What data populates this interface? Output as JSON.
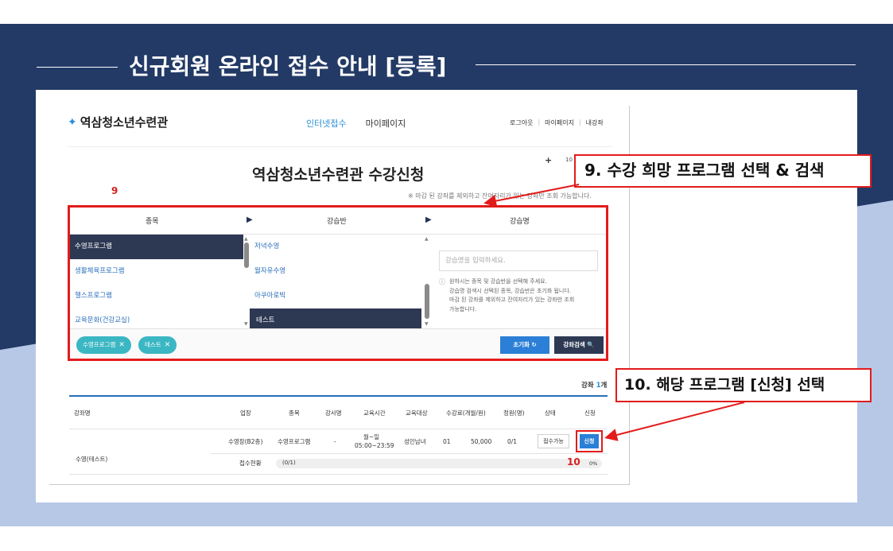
{
  "slide": {
    "title": "신규회원 온라인 접수 안내 [등록]",
    "colors": {
      "navy": "#233a66",
      "light_blue": "#b7c8e6",
      "callout_red": "#e31b1b"
    }
  },
  "site": {
    "logo_text": "역삼청소년수련관",
    "logo_icon": "sprout-icon",
    "nav": [
      "인터넷접수",
      "마이페이지"
    ],
    "util_nav": [
      "로그아웃",
      "마이페이지",
      "내강좌"
    ],
    "zoom_text": "10"
  },
  "page": {
    "heading": "역삼청소년수련관 수강신청",
    "marker_9": "9",
    "notice": "※ 마감 된 강좌를 제외하고 잔여자리가 있는 강좌만 조회 가능합니다."
  },
  "selector": {
    "headers": [
      "종목",
      "강습반",
      "강습명"
    ],
    "categories": [
      "수영프로그램",
      "생활체육프로그램",
      "헬스프로그램",
      "교육문화(건강교실)"
    ],
    "selected_category": 0,
    "classes": [
      "저녁수영",
      "월자유수영",
      "아쿠아로빅",
      "테스트"
    ],
    "selected_class": 3,
    "search_placeholder": "강습명을 입력하세요.",
    "help": [
      "원하시는 종목 및 강습반을 선택해 주세요.",
      "강습명 검색시 선택된 종목, 강습반은 초기화 됩니다.",
      "마감 된 강좌를 제외하고 잔여자리가 있는 강좌만 조회",
      "가능합니다."
    ],
    "chips": [
      "수영프로그램",
      "테스트"
    ],
    "reset_label": "초기화 ↻",
    "search_label": "강좌검색 🔍"
  },
  "results": {
    "count_label": "강좌",
    "count_value": "1",
    "count_unit": "개",
    "columns": [
      "강좌명",
      "업장",
      "종목",
      "강사명",
      "교육시간",
      "교육대상",
      "수강료(개월/원)",
      "정원(명)",
      "상태",
      "신청"
    ],
    "row": {
      "name": "수영(테스트)",
      "venue": "수영장(B2층)",
      "category": "수영프로그램",
      "instructor": "-",
      "days": "월~일",
      "time": "05:00~23:59",
      "target": "성인남녀",
      "months": "01",
      "fee": "50,000",
      "capacity": "0/1",
      "status": "접수가능",
      "apply": "신청"
    },
    "progress_title": "접수현황",
    "progress_label": "(0/1)",
    "progress_pct": "0%",
    "progress_value": 0,
    "marker_10": "10"
  },
  "callouts": {
    "step9": "9. 수강 희망 프로그램 선택 & 검색",
    "step10": "10. 해당 프로그램 [신청] 선택"
  }
}
